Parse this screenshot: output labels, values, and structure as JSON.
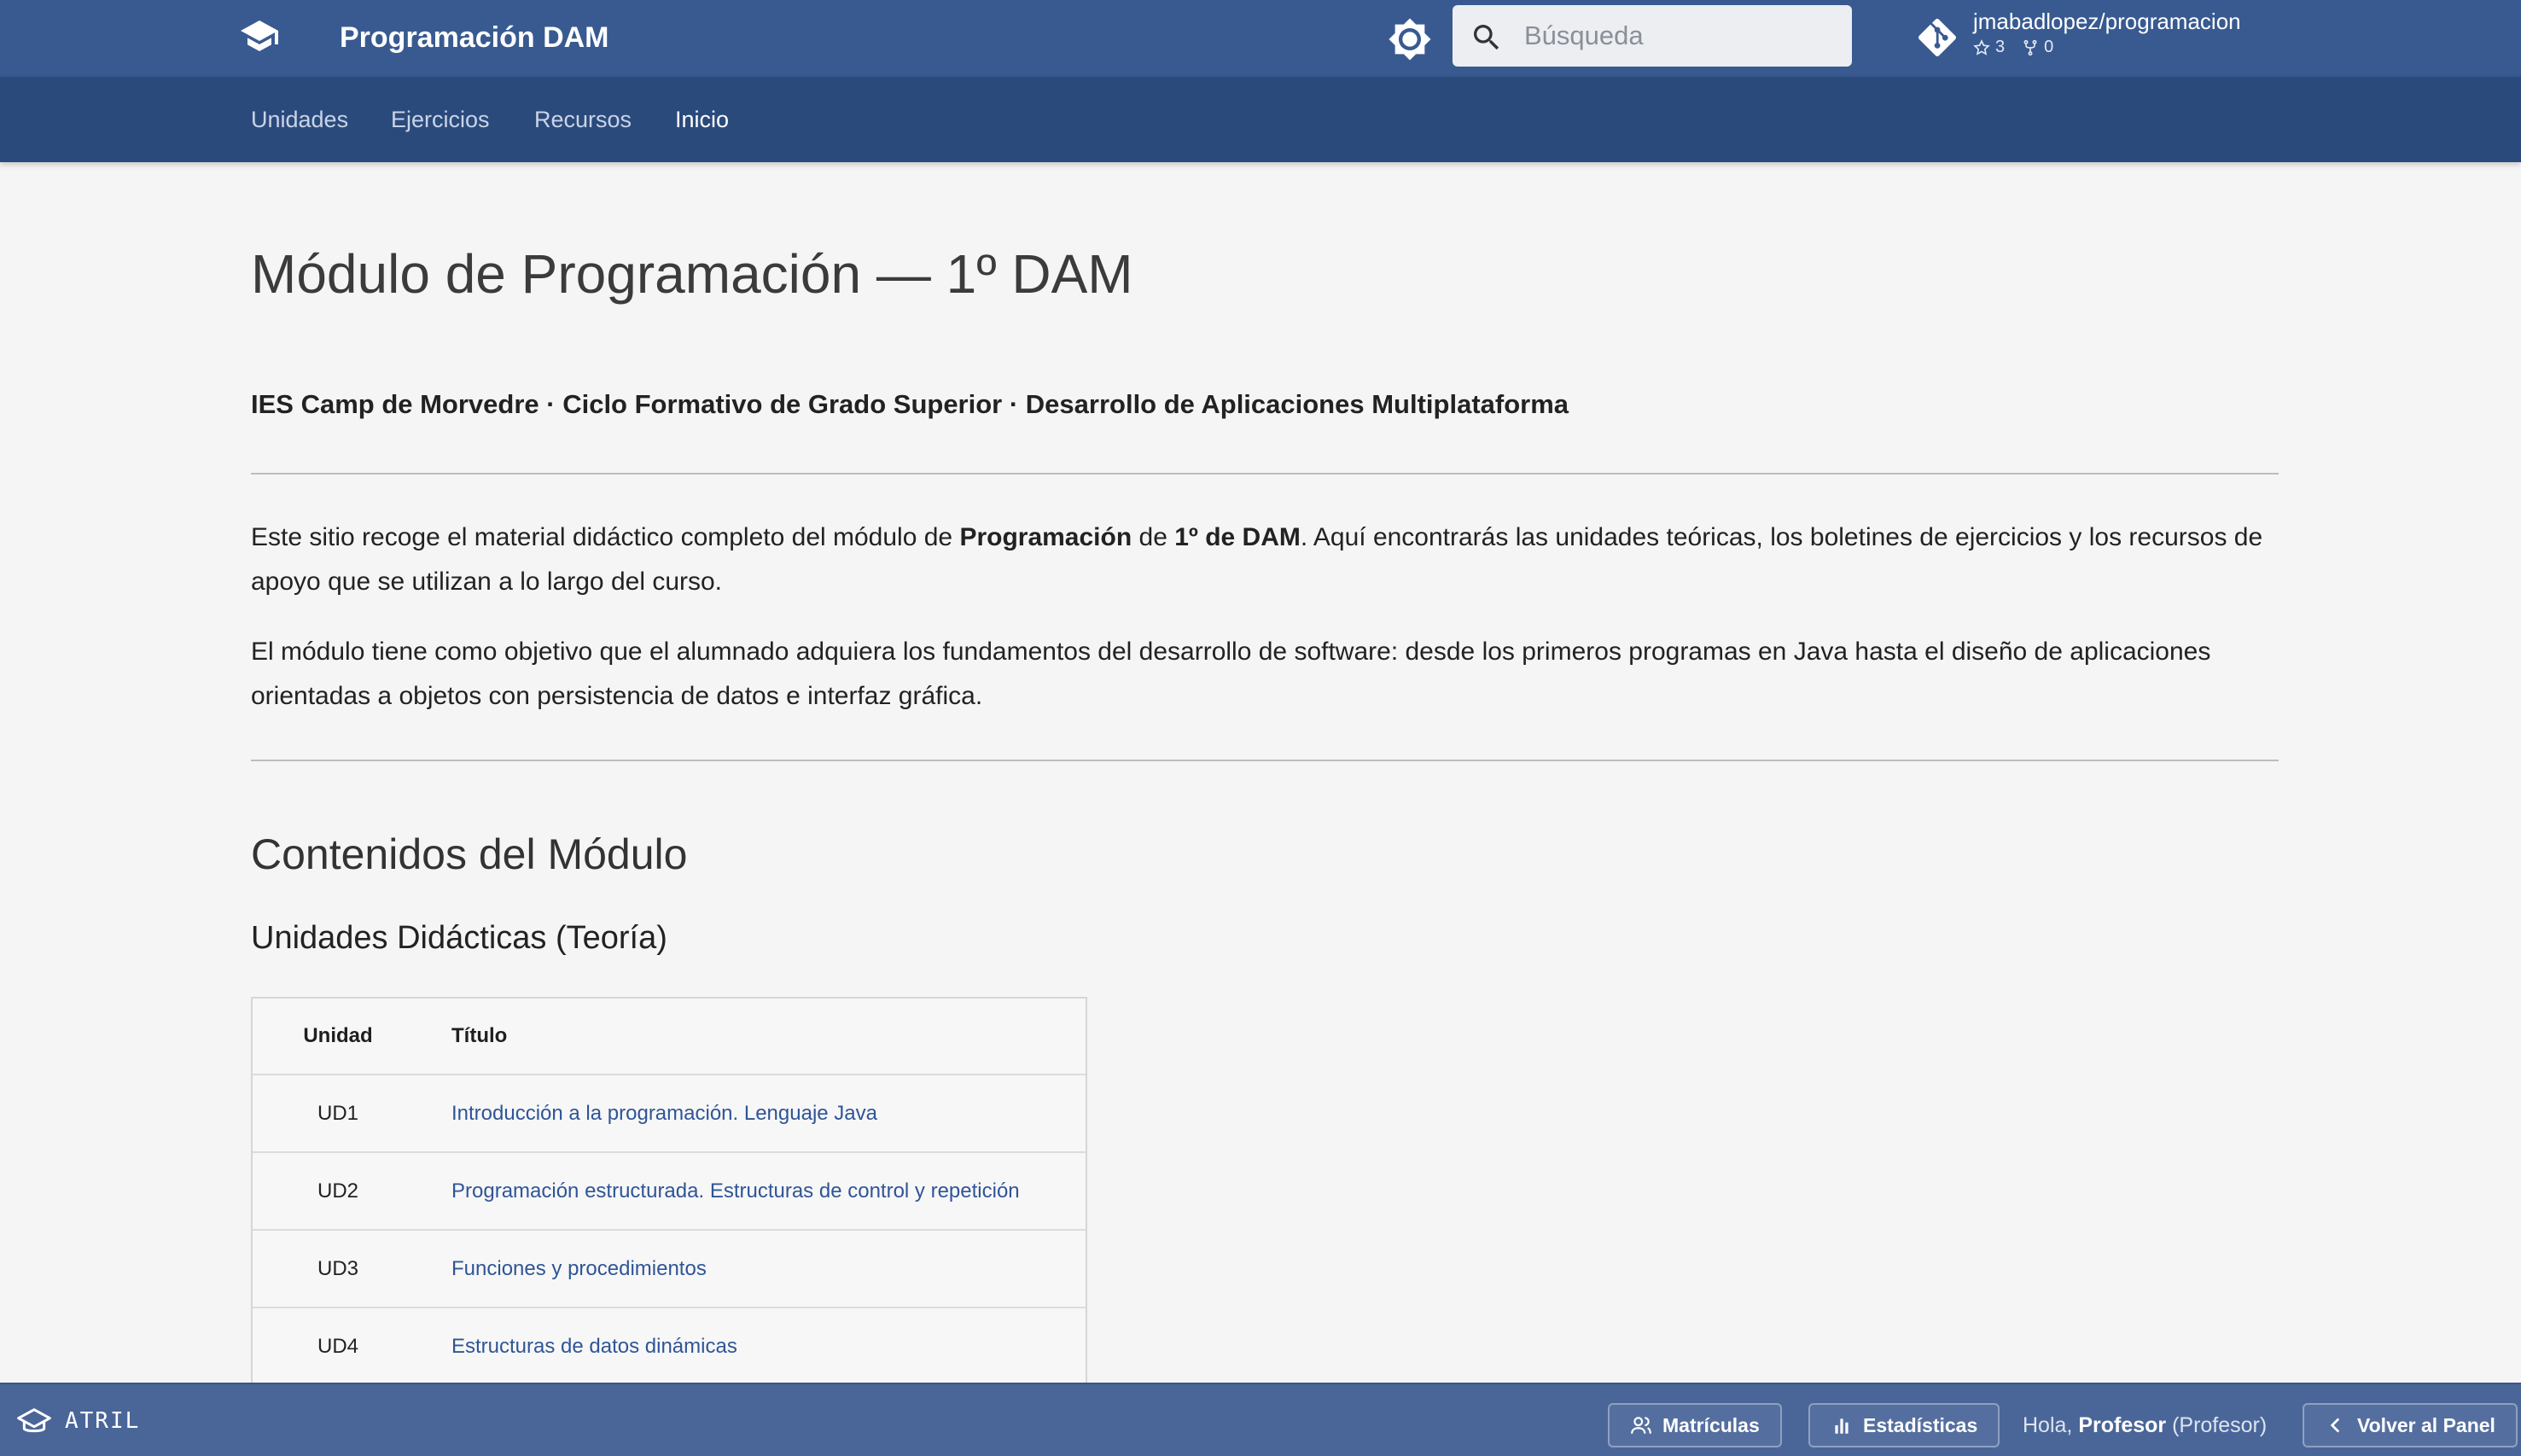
{
  "header": {
    "site_title": "Programación DAM",
    "logo_icon": "graduation-cap-icon",
    "theme_icon": "brightness-icon",
    "search": {
      "placeholder": "Búsqueda",
      "icon": "search-icon"
    },
    "repo": {
      "name": "jmabadlopez/programacion",
      "stars": "3",
      "forks": "0"
    }
  },
  "tabs": [
    {
      "label": "Unidades",
      "active": false
    },
    {
      "label": "Ejercicios",
      "active": false
    },
    {
      "label": "Recursos",
      "active": false
    },
    {
      "label": "Inicio",
      "active": true
    }
  ],
  "main": {
    "title": "Módulo de Programación — 1º DAM",
    "subtitle": "IES Camp de Morvedre · Ciclo Formativo de Grado Superior · Desarrollo de Aplicaciones Multiplataforma",
    "intro": {
      "p1_a": "Este sitio recoge el material didáctico completo del módulo de ",
      "p1_b": "Programación",
      "p1_c": " de ",
      "p1_d": "1º de DAM",
      "p1_e": ". Aquí encontrarás las unidades teóricas, los boletines de ejercicios y los recursos de apoyo que se utilizan a lo largo del curso.",
      "p2": "El módulo tiene como objetivo que el alumnado adquiera los fundamentos del desarrollo de software: desde los primeros programas en Java hasta el diseño de aplicaciones orientadas a objetos con persistencia de datos e interfaz gráfica."
    },
    "contents_heading": "Contenidos del Módulo",
    "units_heading": "Unidades Didácticas (Teoría)",
    "table": {
      "headers": {
        "unit": "Unidad",
        "title": "Título"
      },
      "rows": [
        {
          "unit": "UD1",
          "title": "Introducción a la programación. Lenguaje Java"
        },
        {
          "unit": "UD2",
          "title": "Programación estructurada. Estructuras de control y repetición"
        },
        {
          "unit": "UD3",
          "title": "Funciones y procedimientos"
        },
        {
          "unit": "UD4",
          "title": "Estructuras de datos dinámicas"
        }
      ]
    }
  },
  "bottombar": {
    "brand": "ATRIL",
    "enrollments_label": "Matrículas",
    "stats_label": "Estadísticas",
    "greeting_prefix": "Hola, ",
    "user_name": "Profesor",
    "user_role": " (Profesor)",
    "back_label": "Volver al Panel"
  },
  "colors": {
    "header": "#385a91",
    "tabs": "#2b4a7c",
    "bottombar": "#4a6699",
    "link": "#2f5596",
    "background": "#f5f5f5"
  }
}
